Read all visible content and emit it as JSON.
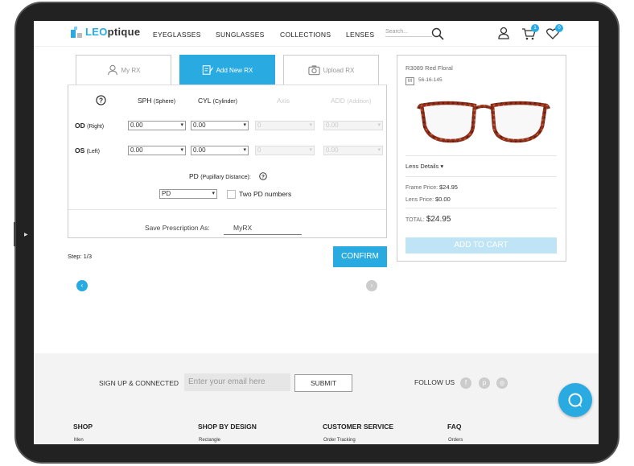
{
  "header": {
    "logo": {
      "prefix": "LEO",
      "suffix": "ptique"
    },
    "nav": [
      "EYEGLASSES",
      "SUNGLASSES",
      "COLLECTIONS",
      "LENSES"
    ],
    "search_placeholder": "Search...",
    "cart_count": "1",
    "wishlist_count": "0"
  },
  "tabs": [
    {
      "label": "My RX",
      "icon": "user-icon"
    },
    {
      "label": "Add New RX",
      "icon": "edit-icon"
    },
    {
      "label": "Upload RX",
      "icon": "camera-icon"
    }
  ],
  "rx_form": {
    "columns": {
      "sph": "SPH",
      "sph_sub": "(Sphere)",
      "cyl": "CYL",
      "cyl_sub": "(Cylinder)",
      "axis": "Axis",
      "add": "ADD",
      "add_sub": "(Addition)"
    },
    "od": {
      "label": "OD",
      "sub": "(Right)",
      "sph": "0.00",
      "cyl": "0.00",
      "axis": "0",
      "add": "0.00"
    },
    "os": {
      "label": "OS",
      "sub": "(Left)",
      "sph": "0.00",
      "cyl": "0.00",
      "axis": "0",
      "add": "0.00"
    },
    "pd": {
      "label": "PD",
      "sub": "(Pupillary Distance):",
      "value": "PD",
      "two_label": "Two PD numbers"
    },
    "save": {
      "label": "Save Prescription As:",
      "value": "MyRX"
    }
  },
  "step": "Step: 1/3",
  "confirm_label": "CONFIRM",
  "product": {
    "name": "R3089 Red Floral",
    "size_badge": "M",
    "size": "56-16-145",
    "lens_details": "Lens Details",
    "frame_price_label": "Frame Price:",
    "frame_price": "$24.95",
    "lens_price_label": "Lens Price:",
    "lens_price": "$0.00",
    "total_label": "TOTAL:",
    "total": "$24.95",
    "add_to_cart": "ADD TO CART"
  },
  "footer": {
    "signup": "SIGN UP & CONNECTED",
    "email_placeholder": "Enter your email here",
    "submit": "SUBMIT",
    "follow": "FOLLOW US",
    "columns": [
      {
        "title": "SHOP",
        "first": "Men"
      },
      {
        "title": "SHOP BY DESIGN",
        "first": "Rectangle"
      },
      {
        "title": "CUSTOMER SERVICE",
        "first": "Order Tracking"
      },
      {
        "title": "FAQ",
        "first": "Orders"
      }
    ]
  },
  "colors": {
    "accent": "#29abe2",
    "frame": "#8b2f1c"
  }
}
